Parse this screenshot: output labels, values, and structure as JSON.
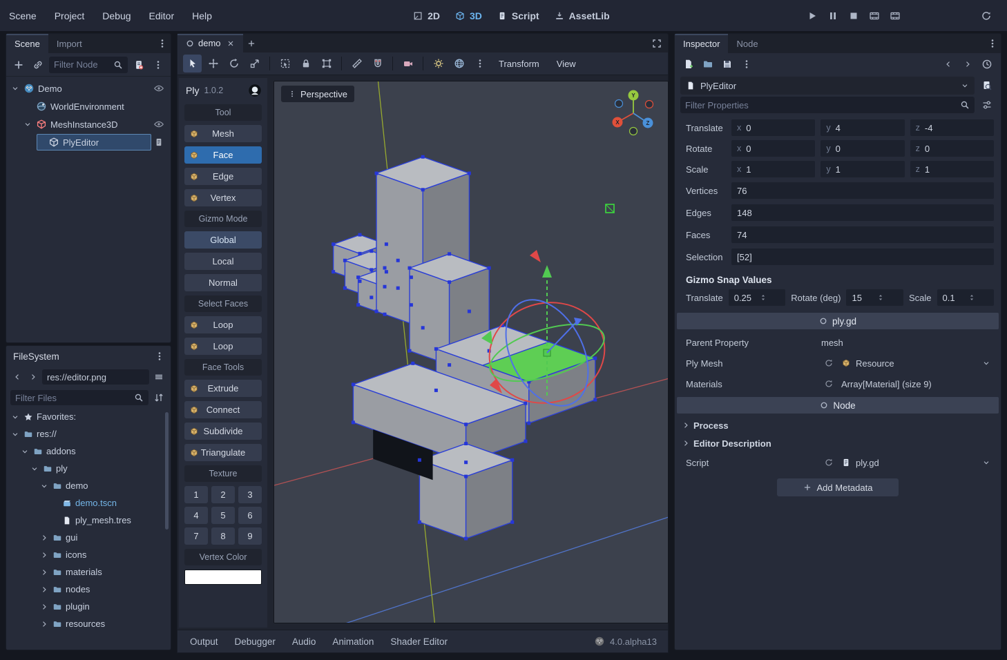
{
  "colors": {
    "accent": "#6cb5f0",
    "selection_blue": "#30496b",
    "face_green": "#56cf4b",
    "folder": "#7fa3c3"
  },
  "menubar": {
    "left": [
      {
        "label": "Scene"
      },
      {
        "label": "Project"
      },
      {
        "label": "Debug"
      },
      {
        "label": "Editor"
      },
      {
        "label": "Help"
      }
    ],
    "workspaces": [
      {
        "label": "2D",
        "icon": "icon2d",
        "active": false
      },
      {
        "label": "3D",
        "icon": "icon3d",
        "active": true
      },
      {
        "label": "Script",
        "icon": "script",
        "active": false
      },
      {
        "label": "AssetLib",
        "icon": "download",
        "active": false
      }
    ],
    "playbar": [
      {
        "icon": "play",
        "name": "play-button"
      },
      {
        "icon": "pause",
        "name": "pause-button"
      },
      {
        "icon": "stop",
        "name": "stop-button"
      },
      {
        "icon": "film",
        "name": "play-movie-button"
      },
      {
        "icon": "film",
        "name": "movie-maker-button"
      }
    ]
  },
  "scene_dock": {
    "tabs": [
      {
        "label": "Scene",
        "active": true
      },
      {
        "label": "Import",
        "active": false
      }
    ],
    "filter_placeholder": "Filter Node",
    "tree": [
      {
        "label": "Demo",
        "depth": 0,
        "icon": "godot",
        "expand": "open",
        "eye": true
      },
      {
        "label": "WorldEnvironment",
        "depth": 1,
        "icon": "world",
        "expand": "none",
        "eye": false
      },
      {
        "label": "MeshInstance3D",
        "depth": 1,
        "icon": "mesh3d",
        "expand": "open",
        "eye": true
      },
      {
        "label": "PlyEditor",
        "depth": 2,
        "icon": "graybox",
        "expand": "none",
        "selected": true,
        "script": true
      }
    ]
  },
  "filesystem": {
    "title": "FileSystem",
    "path": "res://editor.png",
    "filter_placeholder": "Filter Files",
    "tree": [
      {
        "label": "Favorites:",
        "depth": 0,
        "icon": "star",
        "expand": "open"
      },
      {
        "label": "res://",
        "depth": 0,
        "icon": "folder",
        "expand": "open"
      },
      {
        "label": "addons",
        "depth": 1,
        "icon": "folder",
        "expand": "open"
      },
      {
        "label": "ply",
        "depth": 2,
        "icon": "folder",
        "expand": "open"
      },
      {
        "label": "demo",
        "depth": 3,
        "icon": "folder",
        "expand": "open"
      },
      {
        "label": "demo.tscn",
        "depth": 4,
        "icon": "scenefile",
        "expand": "none",
        "highlight": true
      },
      {
        "label": "ply_mesh.tres",
        "depth": 4,
        "icon": "file",
        "expand": "none"
      },
      {
        "label": "gui",
        "depth": 3,
        "icon": "folder",
        "expand": "closed"
      },
      {
        "label": "icons",
        "depth": 3,
        "icon": "folder",
        "expand": "closed"
      },
      {
        "label": "materials",
        "depth": 3,
        "icon": "folder",
        "expand": "closed"
      },
      {
        "label": "nodes",
        "depth": 3,
        "icon": "folder",
        "expand": "closed"
      },
      {
        "label": "plugin",
        "depth": 3,
        "icon": "folder",
        "expand": "closed"
      },
      {
        "label": "resources",
        "depth": 3,
        "icon": "folder",
        "expand": "closed"
      }
    ]
  },
  "main": {
    "scene_tabs": [
      {
        "label": "demo",
        "active": true
      }
    ],
    "perspective_label": "Perspective",
    "axis_labels": [
      "X",
      "Y",
      "Z"
    ]
  },
  "viewport_toolbar": {
    "items": [
      {
        "type": "icon",
        "icon": "cursor",
        "name": "select-tool",
        "active": true
      },
      {
        "type": "icon",
        "icon": "movearrows",
        "name": "move-tool"
      },
      {
        "type": "icon",
        "icon": "rotatearrow",
        "name": "rotate-tool"
      },
      {
        "type": "icon",
        "icon": "scalearrow",
        "name": "scale-tool"
      },
      {
        "type": "sep"
      },
      {
        "type": "icon",
        "icon": "boxselect",
        "name": "box-select-tool"
      },
      {
        "type": "icon",
        "icon": "lock",
        "name": "lock-selected"
      },
      {
        "type": "icon",
        "icon": "group",
        "name": "group-selected"
      },
      {
        "type": "sep"
      },
      {
        "type": "icon",
        "icon": "ruler",
        "name": "ruler-tool"
      },
      {
        "type": "icon",
        "icon": "magnet",
        "name": "snap-toggle"
      },
      {
        "type": "sep"
      },
      {
        "type": "icon",
        "icon": "camera",
        "name": "camera-override"
      },
      {
        "type": "sep"
      },
      {
        "type": "icon",
        "icon": "sun",
        "name": "preview-sun"
      },
      {
        "type": "icon",
        "icon": "globe",
        "name": "preview-environment"
      },
      {
        "type": "icon",
        "icon": "kebab",
        "name": "view-extra-options"
      },
      {
        "type": "menu",
        "label": "Transform"
      },
      {
        "type": "menu",
        "label": "View"
      }
    ]
  },
  "ply_panel": {
    "title": "Ply",
    "version": "1.0.2",
    "rows": [
      {
        "type": "header",
        "label": "Tool"
      },
      {
        "type": "tool",
        "label": "Mesh",
        "icon": "tancube"
      },
      {
        "type": "tool",
        "label": "Face",
        "icon": "tancube",
        "active": true
      },
      {
        "type": "tool",
        "label": "Edge",
        "icon": "tancube"
      },
      {
        "type": "tool",
        "label": "Vertex",
        "icon": "tancube"
      },
      {
        "type": "header",
        "label": "Gizmo Mode"
      },
      {
        "type": "button",
        "label": "Global",
        "active2": true
      },
      {
        "type": "button",
        "label": "Local"
      },
      {
        "type": "button",
        "label": "Normal"
      },
      {
        "type": "header",
        "label": "Select Faces"
      },
      {
        "type": "tool",
        "label": "Loop",
        "icon": "tancube"
      },
      {
        "type": "tool",
        "label": "Loop",
        "icon": "tancube"
      },
      {
        "type": "header",
        "label": "Face Tools"
      },
      {
        "type": "tool",
        "label": "Extrude",
        "icon": "tancube"
      },
      {
        "type": "tool",
        "label": "Connect",
        "icon": "tancube"
      },
      {
        "type": "tool",
        "label": "Subdivide",
        "icon": "tancube"
      },
      {
        "type": "tool",
        "label": "Triangulate",
        "icon": "tancube"
      },
      {
        "type": "header",
        "label": "Texture"
      },
      {
        "type": "grid",
        "cells": [
          "1",
          "2",
          "3",
          "4",
          "5",
          "6",
          "7",
          "8",
          "9"
        ]
      },
      {
        "type": "header",
        "label": "Vertex Color"
      },
      {
        "type": "swatch",
        "color": "#ffffff"
      }
    ]
  },
  "bottom_bar": {
    "items": [
      {
        "label": "Output"
      },
      {
        "label": "Debugger"
      },
      {
        "label": "Audio"
      },
      {
        "label": "Animation"
      },
      {
        "label": "Shader Editor"
      }
    ],
    "version": "4.0.alpha13"
  },
  "inspector": {
    "tabs": [
      {
        "label": "Inspector",
        "active": true
      },
      {
        "label": "Node",
        "active": false
      }
    ],
    "object_name": "PlyEditor",
    "filter_placeholder": "Filter Properties",
    "axes": [
      "x",
      "y",
      "z"
    ],
    "vector_rows": [
      {
        "label": "Translate",
        "x": "0",
        "y": "4",
        "z": "-4"
      },
      {
        "label": "Rotate",
        "x": "0",
        "y": "0",
        "z": "0"
      },
      {
        "label": "Scale",
        "x": "1",
        "y": "1",
        "z": "1"
      }
    ],
    "value_rows": [
      {
        "label": "Vertices",
        "value": "76"
      },
      {
        "label": "Edges",
        "value": "148"
      },
      {
        "label": "Faces",
        "value": "74"
      },
      {
        "label": "Selection",
        "value": "[52]"
      }
    ],
    "snap_section": {
      "title": "Gizmo Snap Values",
      "fields": [
        {
          "label": "Translate",
          "value": "0.25"
        },
        {
          "label": "Rotate (deg)",
          "value": "15"
        },
        {
          "label": "Scale",
          "value": "0.1"
        }
      ]
    },
    "category_ply": "ply.gd",
    "script_props": [
      {
        "label": "Parent Property",
        "value": "mesh",
        "kind": "text"
      },
      {
        "label": "Ply Mesh",
        "value": "Resource",
        "kind": "resource",
        "icon": "tancube",
        "revert": true,
        "chev": true
      },
      {
        "label": "Materials",
        "value": "Array[Material] (size 9)",
        "kind": "array",
        "revert": true
      }
    ],
    "category_node": "Node",
    "collapsed_sections": [
      {
        "label": "Process"
      },
      {
        "label": "Editor Description"
      }
    ],
    "script_row": {
      "label": "Script",
      "value": "ply.gd"
    },
    "add_metadata_label": "Add Metadata"
  }
}
